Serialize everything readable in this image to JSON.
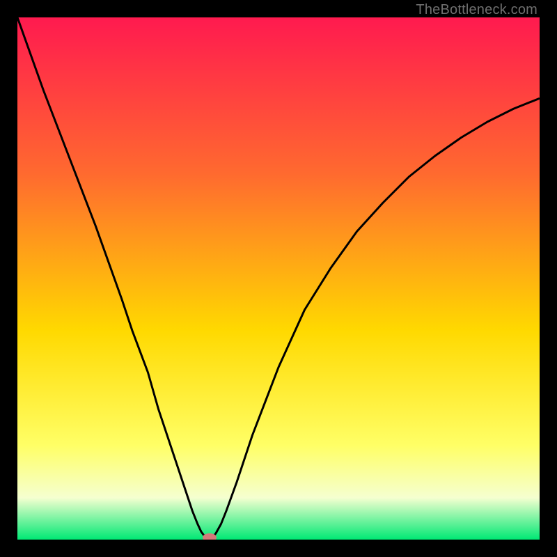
{
  "watermark": "TheBottleneck.com",
  "colors": {
    "frame_bg": "#000000",
    "grad_top": "#ff1a4f",
    "grad_mid1": "#ff6a2f",
    "grad_mid2": "#ffd900",
    "grad_mid3": "#ffff66",
    "grad_mid4": "#f5ffd0",
    "grad_bottom": "#00e874",
    "curve": "#000000",
    "marker": "#d47a7a"
  },
  "chart_data": {
    "type": "line",
    "title": "",
    "xlabel": "",
    "ylabel": "",
    "xlim": [
      0,
      100
    ],
    "ylim": [
      0,
      100
    ],
    "x": [
      0,
      5,
      10,
      15,
      20,
      22,
      25,
      27,
      30,
      32,
      33.5,
      34.5,
      35.2,
      35.8,
      36.3,
      36.75,
      37.3,
      38,
      39,
      40,
      42,
      45,
      50,
      55,
      60,
      65,
      70,
      75,
      80,
      85,
      90,
      95,
      100
    ],
    "values": [
      100,
      86,
      73,
      60,
      46,
      40,
      32,
      25,
      16,
      10,
      5.5,
      3,
      1.5,
      0.7,
      0.2,
      0.1,
      0.3,
      1.2,
      3,
      5.5,
      11,
      20,
      33,
      44,
      52,
      59,
      64.5,
      69.5,
      73.5,
      77,
      80,
      82.5,
      84.5
    ],
    "marker": {
      "x": 36.8,
      "y": 0.4
    },
    "annotations": []
  }
}
